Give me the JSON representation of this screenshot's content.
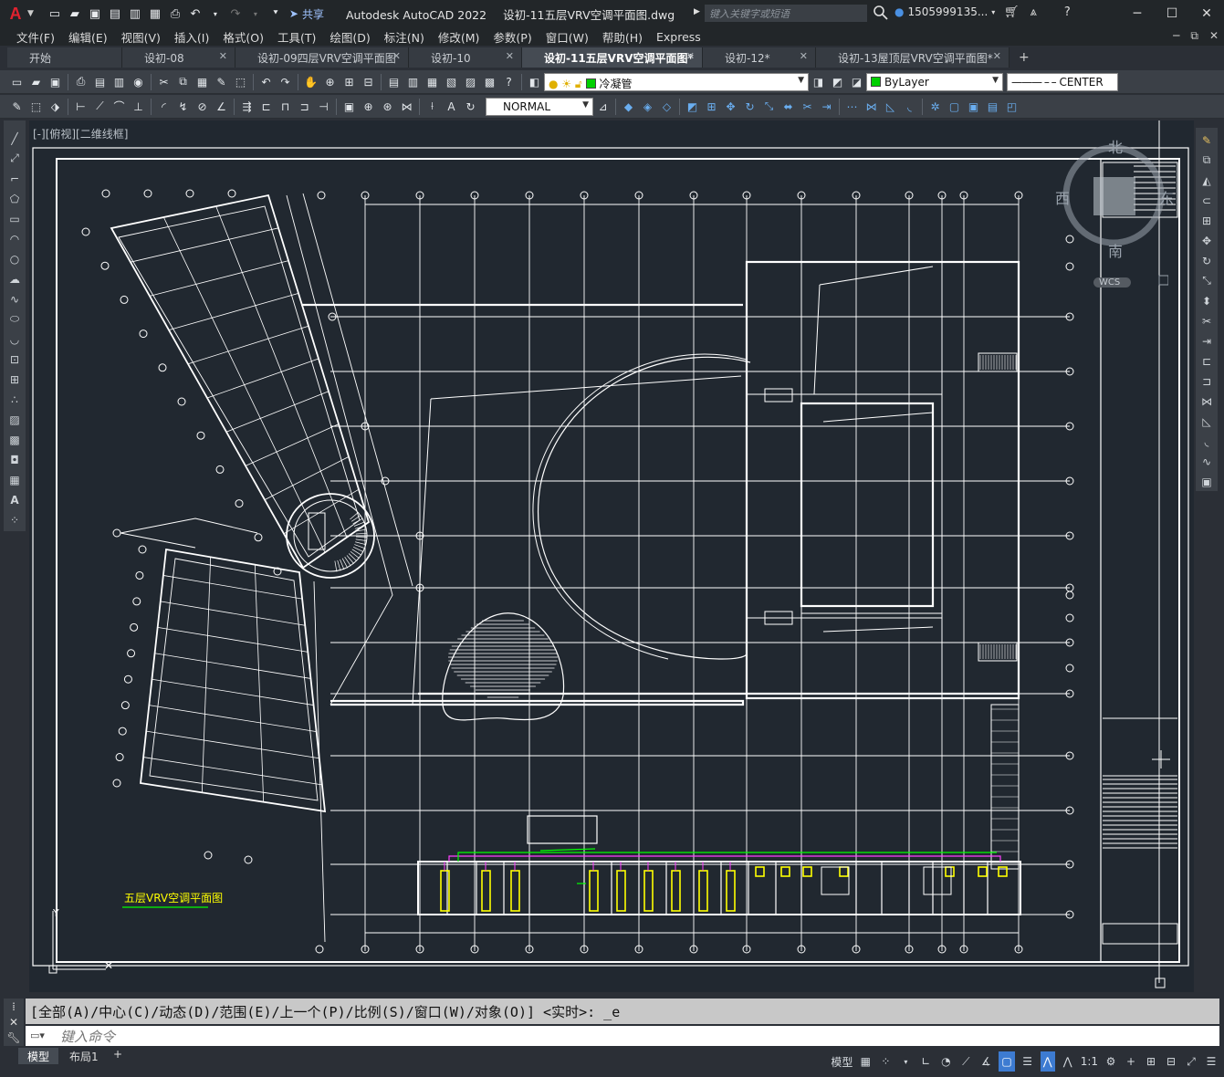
{
  "app": {
    "logo_letter": "A",
    "share_label": "共享",
    "title_app": "Autodesk AutoCAD 2022",
    "title_file": "设初-11五层VRV空调平面图.dwg",
    "search_placeholder": "键入关键字或短语",
    "user_name": "1505999135..."
  },
  "menu": {
    "items": [
      "文件(F)",
      "编辑(E)",
      "视图(V)",
      "插入(I)",
      "格式(O)",
      "工具(T)",
      "绘图(D)",
      "标注(N)",
      "修改(M)",
      "参数(P)",
      "窗口(W)",
      "帮助(H)",
      "Express"
    ]
  },
  "tabs": [
    {
      "label": "开始",
      "active": false,
      "closable": false
    },
    {
      "label": "设初-08",
      "active": false,
      "closable": true
    },
    {
      "label": "设初-09四层VRV空调平面图",
      "active": false,
      "closable": true
    },
    {
      "label": "设初-10",
      "active": false,
      "closable": true
    },
    {
      "label": "设初-11五层VRV空调平面图*",
      "active": true,
      "closable": true
    },
    {
      "label": "设初-12*",
      "active": false,
      "closable": true
    },
    {
      "label": "设初-13屋顶层VRV空调平面图*",
      "active": false,
      "closable": true
    }
  ],
  "toolbar1": {
    "layer_name": "冷凝管",
    "layer_color": "#00d000",
    "color_value": "ByLayer",
    "linetype_value": "CENTER"
  },
  "toolbar2": {
    "dimstyle_value": "NORMAL"
  },
  "viewport": {
    "label": "[-][俯视][二维线框]",
    "drawing_title": "五层VRV空调平面图",
    "viewcube": {
      "north": "北",
      "south": "南",
      "west": "西",
      "east": "东",
      "wcs": "WCS"
    }
  },
  "command": {
    "history": "[全部(A)/中心(C)/动态(D)/范围(E)/上一个(P)/比例(S)/窗口(W)/对象(O)] <实时>: _e",
    "input_placeholder": "键入命令"
  },
  "status": {
    "layout_tabs": [
      "模型",
      "布局1"
    ],
    "model_label": "模型",
    "scale": "1:1"
  },
  "colors": {
    "canvas_bg": "#212830",
    "accent": "#3d7bd1",
    "cad_yellow": "#ffff00",
    "cad_magenta": "#ff00ff",
    "cad_green": "#00ff00"
  }
}
